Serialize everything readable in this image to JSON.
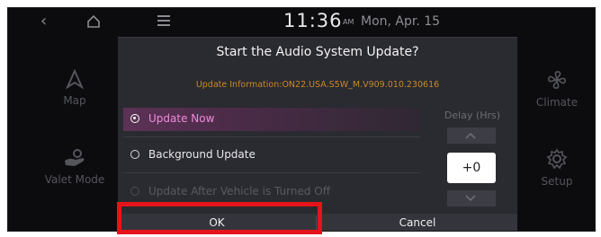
{
  "status_bar": {
    "clock": "11:36",
    "ampm": "AM",
    "date": "Mon, Apr. 15"
  },
  "launcher": {
    "left": [
      {
        "label": "Map",
        "icon": "navigation-arrow-icon"
      },
      {
        "label": "Valet Mode",
        "icon": "valet-hand-icon"
      }
    ],
    "right": [
      {
        "label": "Climate",
        "icon": "fan-icon"
      },
      {
        "label": "Setup",
        "icon": "gear-icon"
      }
    ]
  },
  "popup": {
    "title": "Start the Audio System Update?",
    "info": "Update Information:ON22.USA.S5W_M.V909.010.230616",
    "options": [
      {
        "label": "Update Now",
        "selected": true,
        "enabled": true
      },
      {
        "label": "Background Update",
        "selected": false,
        "enabled": true
      },
      {
        "label": "Update After Vehicle is Turned Off",
        "selected": false,
        "enabled": false
      }
    ],
    "delay": {
      "label": "Delay (Hrs)",
      "value": "+0"
    },
    "buttons": {
      "ok": "OK",
      "cancel": "Cancel"
    }
  },
  "colors": {
    "accent_pink": "#f08bd8",
    "info_orange": "#c98a26",
    "annotation_red": "#e5141a"
  }
}
